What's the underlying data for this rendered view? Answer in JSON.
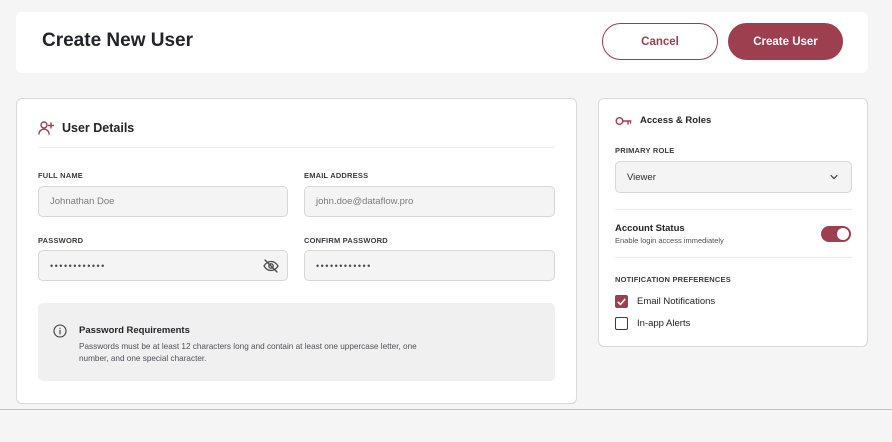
{
  "header": {
    "title": "Create New User",
    "cancel_label": "Cancel",
    "create_label": "Create User"
  },
  "details": {
    "heading": "User Details",
    "heading_icon": "user-plus-icon",
    "full_name": {
      "label": "FULL NAME",
      "value": "Johnathan Doe"
    },
    "email": {
      "label": "EMAIL ADDRESS",
      "value": "john.doe@dataflow.pro"
    },
    "password": {
      "label": "PASSWORD",
      "value": "••••••••••••",
      "toggle_icon": "eye-off-icon"
    },
    "confirm_password": {
      "label": "CONFIRM PASSWORD",
      "value": "••••••••••••"
    },
    "requirements": {
      "icon": "info-icon",
      "title": "Password Requirements",
      "text": "Passwords must be at least 12 characters long and contain at least one uppercase letter, one number, and one special character."
    }
  },
  "access": {
    "heading": "Access & Roles",
    "heading_icon": "key-icon",
    "primary_role": {
      "label": "PRIMARY ROLE",
      "value": "Viewer"
    },
    "account_status": {
      "title": "Account Status",
      "subtitle": "Enable login access immediately",
      "enabled": true
    },
    "notifications": {
      "label": "NOTIFICATION PREFERENCES",
      "options": [
        {
          "label": "Email Notifications",
          "checked": true
        },
        {
          "label": "In-app Alerts",
          "checked": false
        }
      ]
    }
  },
  "colors": {
    "accent": "#9e3f50",
    "background": "#f5f5f5",
    "card": "#ffffff",
    "divider_line": "#e6b7a8"
  }
}
